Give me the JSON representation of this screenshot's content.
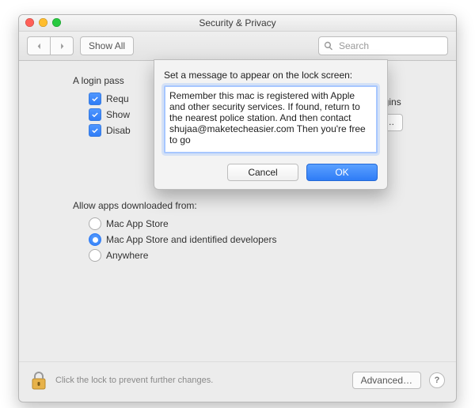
{
  "window": {
    "title": "Security & Privacy"
  },
  "toolbar": {
    "show_all_label": "Show All",
    "search_placeholder": "Search"
  },
  "login": {
    "heading_left": "A login pass",
    "row1_left": "Requ",
    "row1_right": "r begins",
    "row2_left": "Show",
    "row2_right_btn": "ge…",
    "row3_left": "Disab"
  },
  "downloads": {
    "heading": "Allow apps downloaded from:",
    "opt1": "Mac App Store",
    "opt2": "Mac App Store and identified developers",
    "opt3": "Anywhere"
  },
  "footer": {
    "hint": "Click the lock to prevent further changes.",
    "advanced_label": "Advanced…"
  },
  "sheet": {
    "prompt": "Set a message to appear on the lock screen:",
    "message": "Remember this mac is registered with Apple and other security services. If found, return to the nearest police station. And then contact shujaa@maketecheasier.com Then you're free to go",
    "cancel": "Cancel",
    "ok": "OK"
  }
}
